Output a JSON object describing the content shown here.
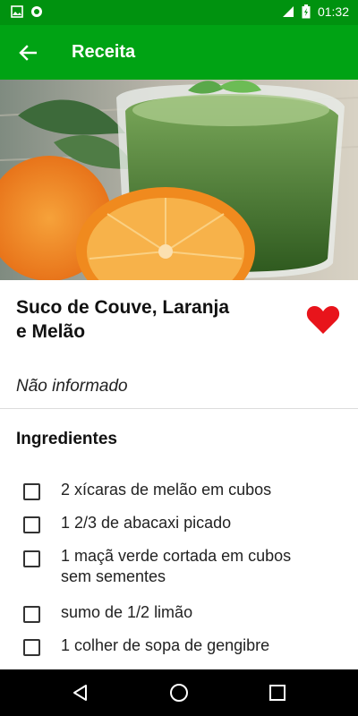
{
  "status_bar": {
    "time": "01:32",
    "left_icons": [
      "image-icon",
      "record-icon"
    ],
    "right_icons": [
      "signal-icon",
      "battery-icon"
    ]
  },
  "app_bar": {
    "title": "Receita",
    "back_icon": "arrow-back-icon"
  },
  "recipe": {
    "title_line1": "Suco de Couve, Laranja",
    "title_line2": "e Melão",
    "subtitle": "Não informado",
    "favorite_icon": "heart-icon",
    "favorite_color": "#e8141b"
  },
  "ingredients": {
    "heading": "Ingredientes",
    "items": [
      {
        "line1": "2 xícaras de melão em cubos",
        "line2": ""
      },
      {
        "line1": "1 2/3 de abacaxi picado",
        "line2": ""
      },
      {
        "line1": "1 maçã verde cortada em cubos",
        "line2": "sem sementes"
      },
      {
        "line1": "sumo de 1/2 limão",
        "line2": ""
      },
      {
        "line1": "1 colher de sopa de gengibre",
        "line2": ""
      }
    ]
  },
  "nav_bar": {
    "icons": [
      "back-triangle-icon",
      "home-circle-icon",
      "recents-square-icon"
    ]
  },
  "colors": {
    "status_bar": "#00920f",
    "app_bar": "#00a314",
    "heart": "#e8141b"
  }
}
